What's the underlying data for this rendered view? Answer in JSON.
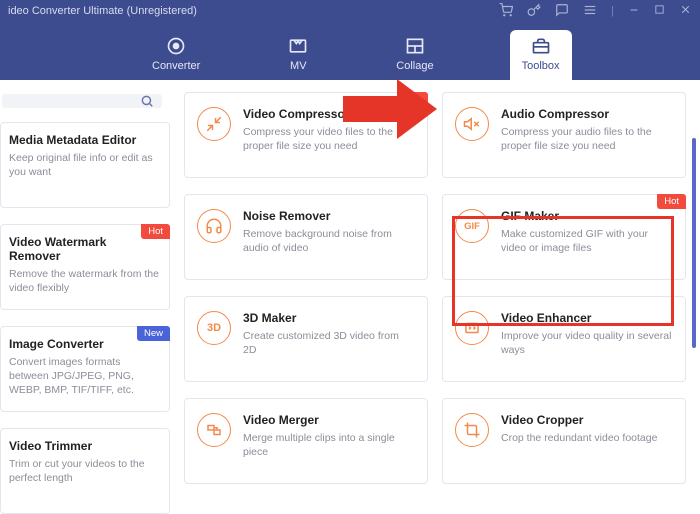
{
  "window": {
    "title": "ideo Converter Ultimate (Unregistered)"
  },
  "nav": {
    "items": [
      {
        "label": "Converter"
      },
      {
        "label": "MV"
      },
      {
        "label": "Collage"
      },
      {
        "label": "Toolbox"
      }
    ],
    "active": 3
  },
  "search": {
    "placeholder": ""
  },
  "badges": {
    "hot": "Hot",
    "new": "New"
  },
  "cards": {
    "media_metadata": {
      "title": "Media Metadata Editor",
      "desc": "Keep original file info or edit as you want"
    },
    "watermark": {
      "title": "Video Watermark Remover",
      "desc": "Remove the watermark from the video flexibly"
    },
    "image_conv": {
      "title": "Image Converter",
      "desc": "Convert images formats between JPG/JPEG, PNG, WEBP, BMP, TIF/TIFF, etc."
    },
    "trimmer": {
      "title": "Video Trimmer",
      "desc": "Trim or cut your videos to the perfect length"
    },
    "vcompress": {
      "title": "Video Compressor",
      "desc": "Compress your video files to the proper file size you need"
    },
    "noise": {
      "title": "Noise Remover",
      "desc": "Remove background noise from audio of video"
    },
    "maker3d": {
      "title": "3D Maker",
      "desc": "Create customized 3D video from 2D",
      "icon_text": "3D"
    },
    "merger": {
      "title": "Video Merger",
      "desc": "Merge multiple clips into a single piece"
    },
    "acompress": {
      "title": "Audio Compressor",
      "desc": "Compress your audio files to the proper file size you need"
    },
    "gif": {
      "title": "GIF Maker",
      "desc": "Make customized GIF with your video or image files",
      "icon_text": "GIF"
    },
    "enhancer": {
      "title": "Video Enhancer",
      "desc": "Improve your video quality in several ways"
    },
    "cropper": {
      "title": "Video Cropper",
      "desc": "Crop the redundant video footage"
    }
  }
}
